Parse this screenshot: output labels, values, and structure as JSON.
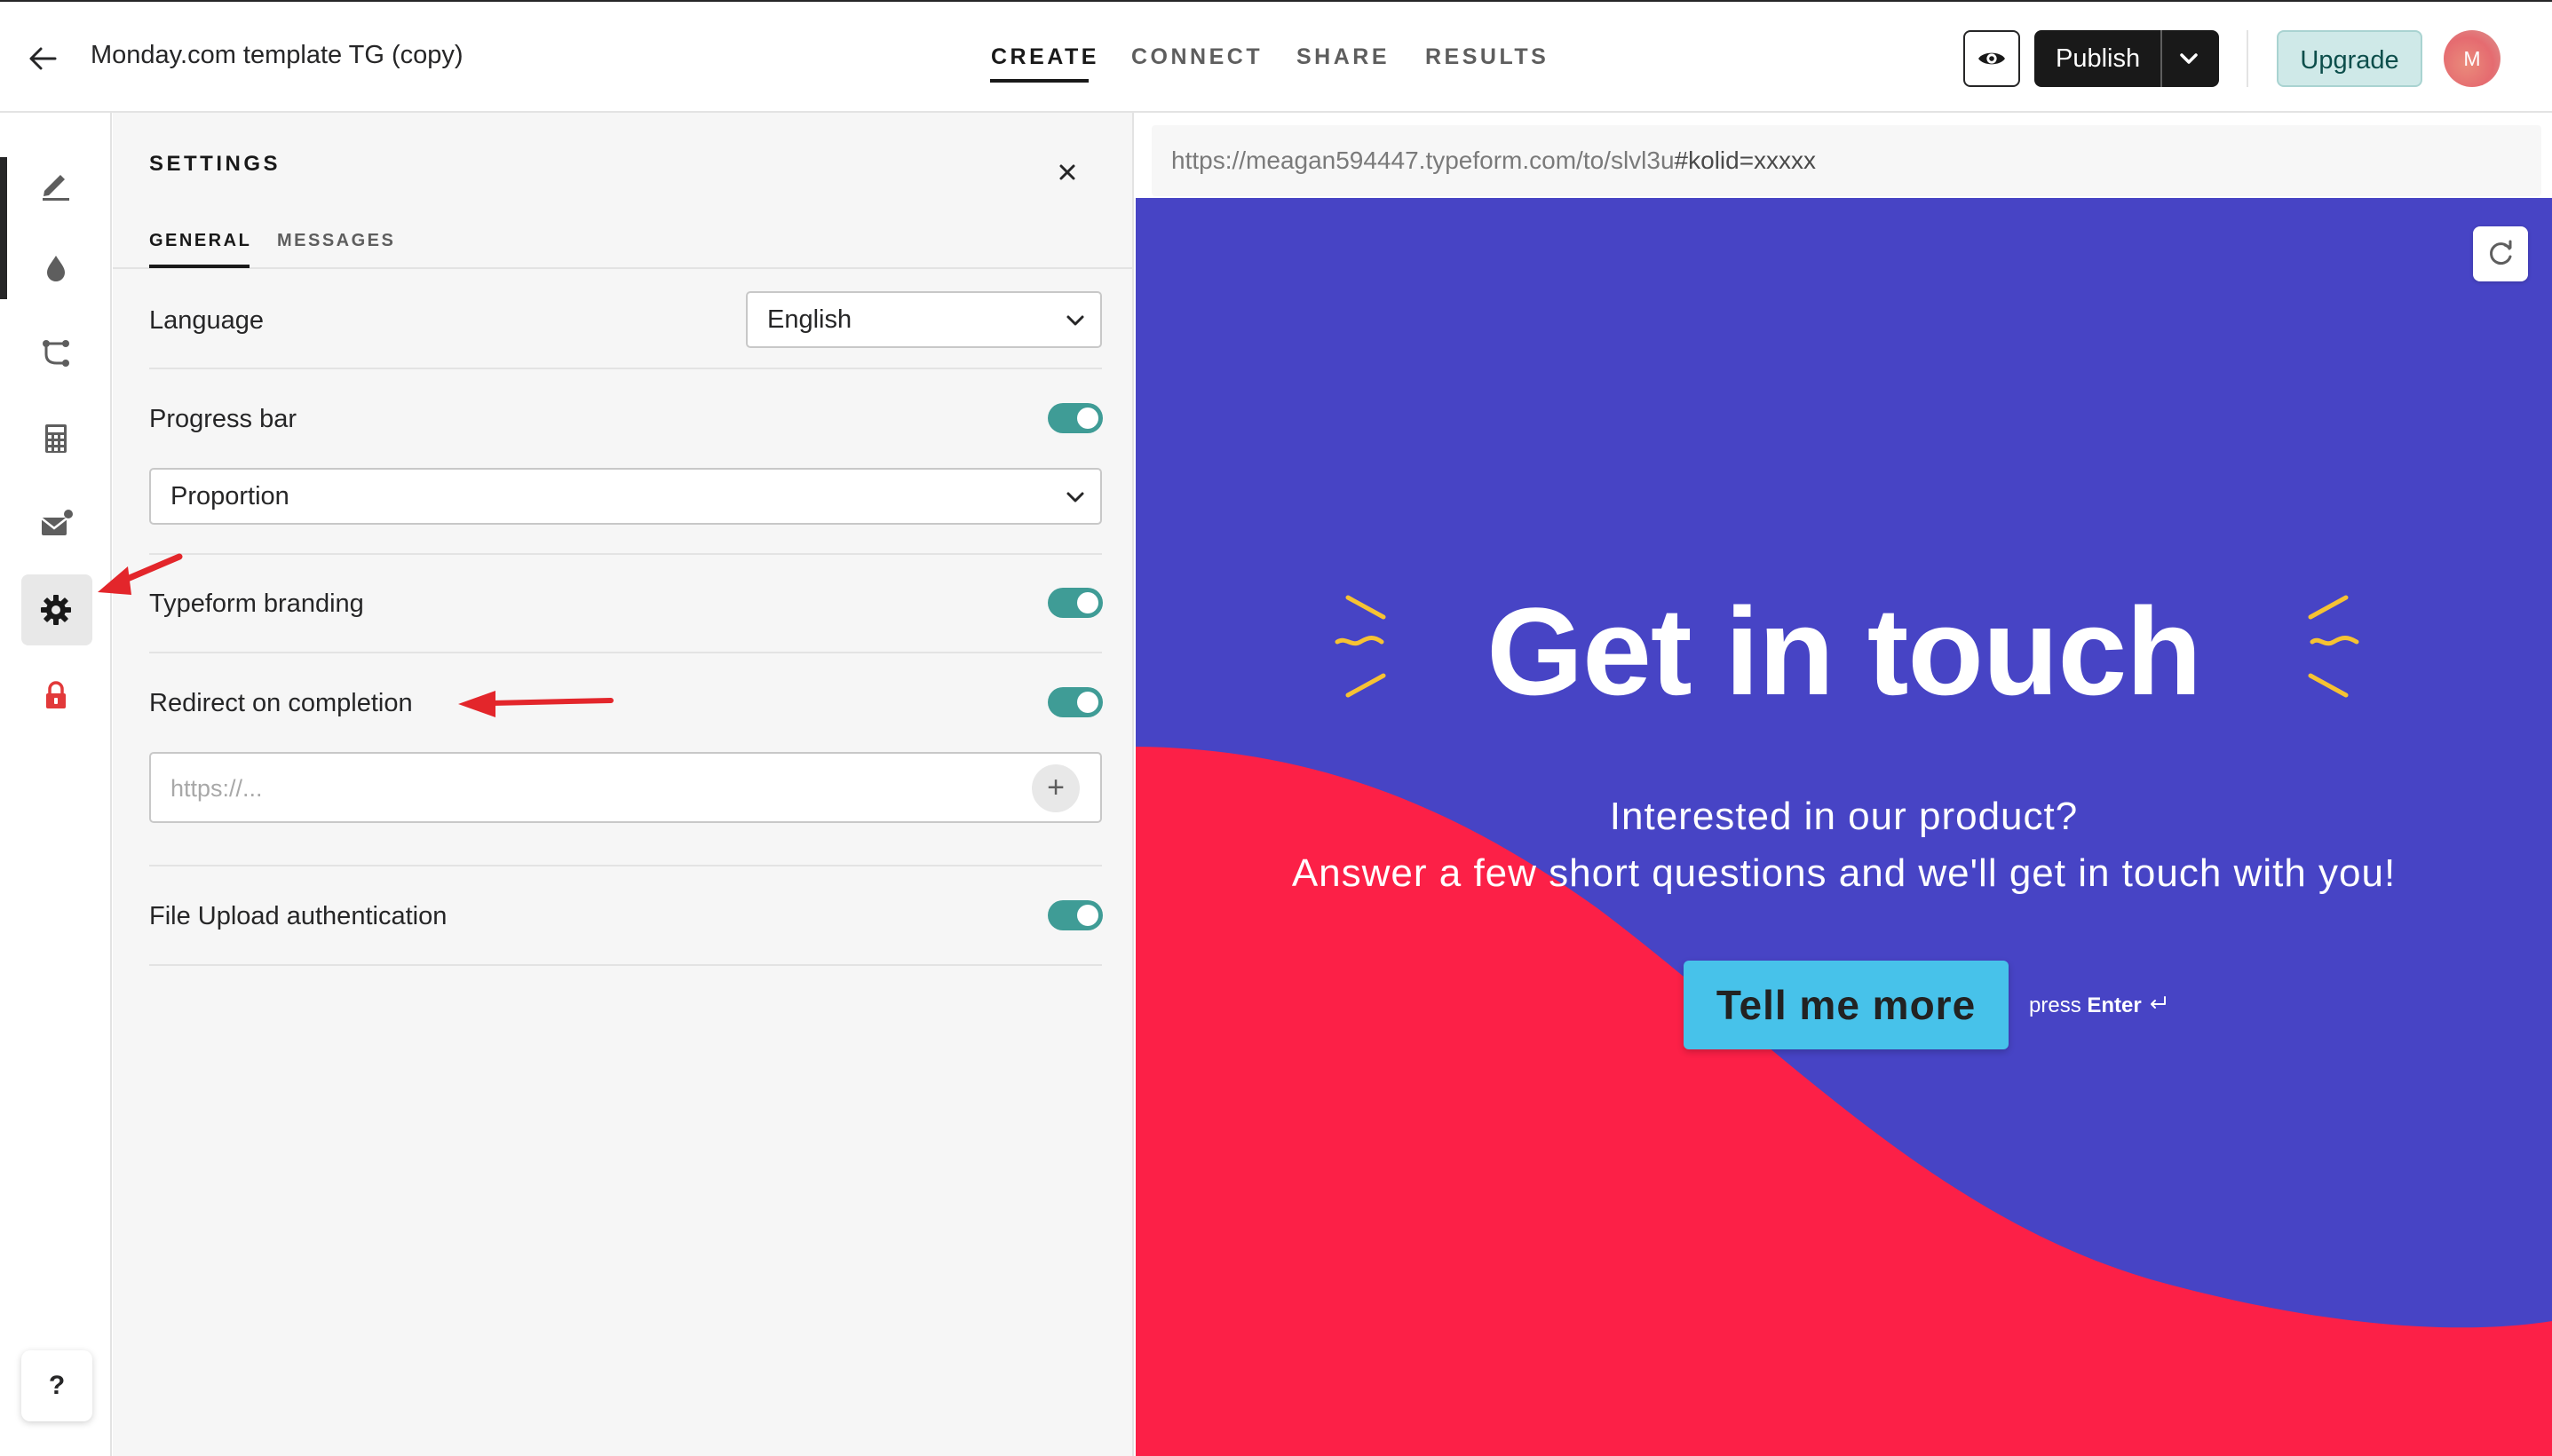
{
  "header": {
    "form_title": "Monday.com template TG (copy)",
    "tabs": [
      {
        "label": "CREATE",
        "active": true
      },
      {
        "label": "CONNECT",
        "active": false
      },
      {
        "label": "SHARE",
        "active": false
      },
      {
        "label": "RESULTS",
        "active": false
      }
    ],
    "publish_label": "Publish",
    "upgrade_label": "Upgrade",
    "avatar_initial": "M"
  },
  "sidebar": {
    "items": [
      {
        "icon": "pen-icon"
      },
      {
        "icon": "drop-icon"
      },
      {
        "icon": "logic-icon"
      },
      {
        "icon": "calculator-icon"
      },
      {
        "icon": "mail-icon"
      },
      {
        "icon": "gear-icon",
        "active": true
      },
      {
        "icon": "lock-icon"
      }
    ],
    "help_label": "?"
  },
  "settings": {
    "title": "SETTINGS",
    "tabs": [
      {
        "label": "GENERAL",
        "active": true
      },
      {
        "label": "MESSAGES",
        "active": false
      }
    ],
    "language": {
      "label": "Language",
      "value": "English"
    },
    "progress_bar": {
      "label": "Progress bar",
      "enabled": true,
      "value": "Proportion"
    },
    "branding": {
      "label": "Typeform branding",
      "enabled": true
    },
    "redirect": {
      "label": "Redirect on completion",
      "enabled": true,
      "placeholder": "https://..."
    },
    "file_upload": {
      "label": "File Upload authentication",
      "enabled": true
    }
  },
  "preview": {
    "url_prefix": "https://meagan594447.typeform.com/to/slvl3u",
    "url_hash": "#kolid=xxxxx",
    "headline": "Get in touch",
    "subline_1": "Interested in our product?",
    "subline_2": "Answer a few short questions and we'll get in touch with you!",
    "cta_label": "Tell me more",
    "press_prefix": "press",
    "press_key": "Enter",
    "colors": {
      "background": "#4744c5",
      "wave": "#fc2047",
      "button": "#47c2ea",
      "accent": "#f6c233"
    }
  },
  "colors": {
    "toggle_on": "#3f9c96",
    "annotation_arrow": "#e3262b"
  }
}
